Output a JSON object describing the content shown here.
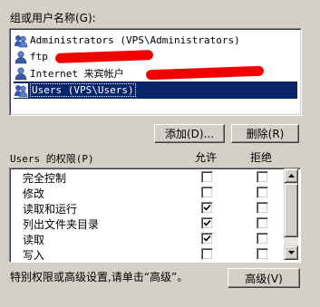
{
  "groups_label": "组或用户名称(G):",
  "principals": [
    {
      "name": "Administrators (VPS\\Administrators)",
      "selected": false,
      "redacted": false
    },
    {
      "name": "ftp",
      "selected": false,
      "redacted": true
    },
    {
      "name": "Internet 来宾帐户",
      "selected": false,
      "redacted": true
    },
    {
      "name": "Users (VPS\\Users)",
      "selected": true,
      "redacted": false
    }
  ],
  "buttons": {
    "add": "添加(D)...",
    "remove": "删除(R)",
    "advanced": "高级(V)"
  },
  "permissions": {
    "label": "Users 的权限(P)",
    "allow_header": "允许",
    "deny_header": "拒绝",
    "rows": [
      {
        "name": "完全控制",
        "allow": false,
        "deny": false
      },
      {
        "name": "修改",
        "allow": false,
        "deny": false
      },
      {
        "name": "读取和运行",
        "allow": true,
        "deny": false
      },
      {
        "name": "列出文件夹目录",
        "allow": true,
        "deny": false
      },
      {
        "name": "读取",
        "allow": true,
        "deny": false
      },
      {
        "name": "写入",
        "allow": false,
        "deny": false
      }
    ]
  },
  "special_note": "特别权限或高级设置,请单击“高级”。",
  "icons": {
    "principal": "user-group-icon",
    "check": "checkmark-icon",
    "scroll_up": "arrow-up-icon",
    "scroll_down": "arrow-down-icon"
  },
  "colors": {
    "dialog_bg": "#d4d0c8",
    "selection_bg": "#0a246a",
    "selection_text": "#ffffff",
    "redaction": "#f20000"
  }
}
